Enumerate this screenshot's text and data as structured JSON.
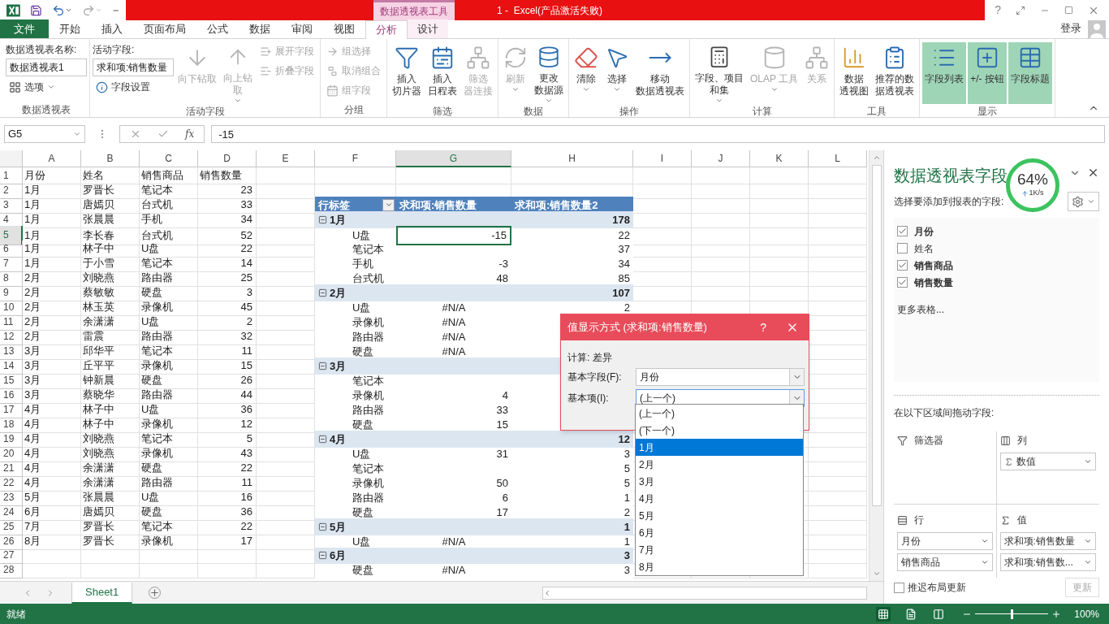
{
  "titlebar": {
    "context_tab": "数据透视表工具",
    "title": "1 -  Excel(产品激活失败)",
    "help": "?"
  },
  "tabs": [
    {
      "label": "文件",
      "kind": "file",
      "selected": false
    },
    {
      "label": "开始",
      "kind": "normal",
      "selected": false
    },
    {
      "label": "插入",
      "kind": "normal",
      "selected": false
    },
    {
      "label": "页面布局",
      "kind": "normal",
      "selected": false
    },
    {
      "label": "公式",
      "kind": "normal",
      "selected": false
    },
    {
      "label": "数据",
      "kind": "normal",
      "selected": false
    },
    {
      "label": "审阅",
      "kind": "normal",
      "selected": false
    },
    {
      "label": "视图",
      "kind": "normal",
      "selected": false
    },
    {
      "label": "分析",
      "kind": "context",
      "selected": true
    },
    {
      "label": "设计",
      "kind": "context",
      "selected": false
    }
  ],
  "account": {
    "label": "登录"
  },
  "ribbon": {
    "groups": [
      {
        "label": "数据透视表",
        "columns": [
          [
            {
              "kind": "caption",
              "label": "数据透视表名称:"
            },
            {
              "kind": "input",
              "value": "数据透视表1"
            },
            {
              "kind": "small",
              "label": "选项",
              "menu": true,
              "disabled": false
            }
          ]
        ]
      },
      {
        "label": "活动字段",
        "columns": [
          [
            {
              "kind": "caption",
              "label": "活动字段:"
            },
            {
              "kind": "input",
              "value": "求和项:销售数量"
            },
            {
              "kind": "small",
              "label": "字段设置",
              "menu": false,
              "disabled": false
            }
          ],
          [
            {
              "kind": "large",
              "label": "向下钻取",
              "menu": false,
              "disabled": true
            }
          ],
          [
            {
              "kind": "large",
              "label": "向上钻取",
              "menu": true,
              "disabled": true
            }
          ],
          [
            {
              "kind": "small",
              "label": "展开字段",
              "menu": false,
              "disabled": true
            },
            {
              "kind": "small",
              "label": "折叠字段",
              "menu": false,
              "disabled": true
            }
          ]
        ]
      },
      {
        "label": "分组",
        "columns": [
          [
            {
              "kind": "small",
              "label": "组选择",
              "menu": false,
              "disabled": true
            },
            {
              "kind": "small",
              "label": "取消组合",
              "menu": false,
              "disabled": true
            },
            {
              "kind": "small",
              "label": "组字段",
              "menu": false,
              "disabled": true
            }
          ]
        ]
      },
      {
        "label": "筛选",
        "columns": [
          [
            {
              "kind": "large",
              "label": "插入切片器",
              "menu": false,
              "disabled": false
            }
          ],
          [
            {
              "kind": "large",
              "label": "插入日程表",
              "menu": false,
              "disabled": false
            }
          ],
          [
            {
              "kind": "large",
              "label": "筛选器连接",
              "menu": false,
              "disabled": true
            }
          ]
        ]
      },
      {
        "label": "数据",
        "columns": [
          [
            {
              "kind": "large",
              "label": "刷新",
              "menu": true,
              "disabled": true
            }
          ],
          [
            {
              "kind": "large",
              "label": "更改数据源",
              "menu": true,
              "disabled": false
            }
          ]
        ]
      },
      {
        "label": "操作",
        "columns": [
          [
            {
              "kind": "large",
              "label": "清除",
              "menu": true,
              "disabled": false
            }
          ],
          [
            {
              "kind": "large",
              "label": "选择",
              "menu": true,
              "disabled": false
            }
          ],
          [
            {
              "kind": "large",
              "label": "移动数据透视表",
              "menu": false,
              "disabled": false
            }
          ]
        ]
      },
      {
        "label": "计算",
        "columns": [
          [
            {
              "kind": "large",
              "label": "字段、项目和集",
              "menu": true,
              "disabled": false
            }
          ],
          [
            {
              "kind": "large",
              "label": "OLAP 工具",
              "menu": true,
              "disabled": true
            }
          ],
          [
            {
              "kind": "large",
              "label": "关系",
              "menu": false,
              "disabled": true
            }
          ]
        ]
      },
      {
        "label": "工具",
        "columns": [
          [
            {
              "kind": "large",
              "label": "数据透视图",
              "menu": false,
              "disabled": false
            }
          ],
          [
            {
              "kind": "large",
              "label": "推荐的数据透视表",
              "menu": false,
              "disabled": false
            }
          ]
        ]
      },
      {
        "label": "显示",
        "columns": [
          [
            {
              "kind": "large",
              "label": "字段列表",
              "menu": false,
              "disabled": false,
              "selected": true
            }
          ],
          [
            {
              "kind": "large",
              "label": "+/- 按钮",
              "menu": false,
              "disabled": false,
              "selected": true
            }
          ],
          [
            {
              "kind": "large",
              "label": "字段标题",
              "menu": false,
              "disabled": false,
              "selected": true
            }
          ]
        ]
      }
    ]
  },
  "formula_bar": {
    "name_box": "G5",
    "function_label": "fx",
    "formula": "-15"
  },
  "sheet": {
    "columns": [
      {
        "label": "A",
        "selected": false
      },
      {
        "label": "B",
        "selected": false
      },
      {
        "label": "C",
        "selected": false
      },
      {
        "label": "D",
        "selected": false
      },
      {
        "label": "E",
        "selected": false
      },
      {
        "label": "F",
        "selected": false
      },
      {
        "label": "G",
        "selected": true
      },
      {
        "label": "H",
        "selected": false
      },
      {
        "label": "I",
        "selected": false
      },
      {
        "label": "J",
        "selected": false
      },
      {
        "label": "K",
        "selected": false
      },
      {
        "label": "L",
        "selected": false
      }
    ],
    "rows": [
      {
        "number": "1",
        "selected": false,
        "cells": [
          "月份",
          "姓名",
          "销售商品",
          "销售数量"
        ]
      },
      {
        "number": "2",
        "selected": false,
        "cells": [
          "1月",
          "罗晋长",
          "笔记本",
          "23"
        ]
      },
      {
        "number": "3",
        "selected": false,
        "cells": [
          "1月",
          "唐嫣贝",
          "台式机",
          "33"
        ],
        "pivot": {
          "kind": "header",
          "label": "行标签",
          "value": "求和项:销售数量",
          "total": "求和项:销售数量2"
        }
      },
      {
        "number": "4",
        "selected": false,
        "cells": [
          "1月",
          "张晨晨",
          "手机",
          "34"
        ],
        "pivot": {
          "kind": "group",
          "label": "1月",
          "total": "178"
        }
      },
      {
        "number": "5",
        "selected": true,
        "cells": [
          "1月",
          "李长春",
          "台式机",
          "52"
        ],
        "pivot": {
          "kind": "item",
          "label": "U盘",
          "value": "-15",
          "total": "22",
          "value_error": false,
          "value_selected": true
        }
      },
      {
        "number": "6",
        "selected": false,
        "cells": [
          "1月",
          "林子中",
          "U盘",
          "22"
        ],
        "pivot": {
          "kind": "item",
          "label": "笔记本",
          "total": "37",
          "value_selected": false
        }
      },
      {
        "number": "7",
        "selected": false,
        "cells": [
          "1月",
          "于小雪",
          "笔记本",
          "14"
        ],
        "pivot": {
          "kind": "item",
          "label": "手机",
          "value": "-3",
          "total": "34",
          "value_error": false,
          "value_selected": false
        }
      },
      {
        "number": "8",
        "selected": false,
        "cells": [
          "2月",
          "刘晓燕",
          "路由器",
          "25"
        ],
        "pivot": {
          "kind": "item",
          "label": "台式机",
          "value": "48",
          "total": "85",
          "value_error": false,
          "value_selected": false
        }
      },
      {
        "number": "9",
        "selected": false,
        "cells": [
          "2月",
          "蔡敏敏",
          "硬盘",
          "3"
        ],
        "pivot": {
          "kind": "group",
          "label": "2月",
          "total": "107"
        }
      },
      {
        "number": "10",
        "selected": false,
        "cells": [
          "2月",
          "林玉英",
          "录像机",
          "45"
        ],
        "pivot": {
          "kind": "item",
          "label": "U盘",
          "value": "#N/A",
          "total": "2",
          "value_error": true,
          "value_selected": false
        }
      },
      {
        "number": "11",
        "selected": false,
        "cells": [
          "2月",
          "余潇潇",
          "U盘",
          "2"
        ],
        "pivot": {
          "kind": "item",
          "label": "录像机",
          "value": "#N/A",
          "value_error": true,
          "value_selected": false
        }
      },
      {
        "number": "12",
        "selected": false,
        "cells": [
          "2月",
          "雷震",
          "路由器",
          "32"
        ],
        "pivot": {
          "kind": "item",
          "label": "路由器",
          "value": "#N/A",
          "value_error": true,
          "value_selected": false
        }
      },
      {
        "number": "13",
        "selected": false,
        "cells": [
          "3月",
          "邱华平",
          "笔记本",
          "11"
        ],
        "pivot": {
          "kind": "item",
          "label": "硬盘",
          "value": "#N/A",
          "value_error": true,
          "value_selected": false
        }
      },
      {
        "number": "14",
        "selected": false,
        "cells": [
          "3月",
          "丘平平",
          "录像机",
          "15"
        ],
        "pivot": {
          "kind": "group",
          "label": "3月"
        }
      },
      {
        "number": "15",
        "selected": false,
        "cells": [
          "3月",
          "钟新晨",
          "硬盘",
          "26"
        ],
        "pivot": {
          "kind": "item",
          "label": "笔记本",
          "value_selected": false
        }
      },
      {
        "number": "16",
        "selected": false,
        "cells": [
          "3月",
          "蔡晓华",
          "路由器",
          "44"
        ],
        "pivot": {
          "kind": "item",
          "label": "录像机",
          "value": "4",
          "value_error": false,
          "value_selected": false
        }
      },
      {
        "number": "17",
        "selected": false,
        "cells": [
          "4月",
          "林子中",
          "U盘",
          "36"
        ],
        "pivot": {
          "kind": "item",
          "label": "路由器",
          "value": "33",
          "value_error": false,
          "value_selected": false
        }
      },
      {
        "number": "18",
        "selected": false,
        "cells": [
          "4月",
          "林子中",
          "录像机",
          "12"
        ],
        "pivot": {
          "kind": "item",
          "label": "硬盘",
          "value": "15",
          "value_error": false,
          "value_selected": false
        }
      },
      {
        "number": "19",
        "selected": false,
        "cells": [
          "4月",
          "刘晓燕",
          "笔记本",
          "5"
        ],
        "pivot": {
          "kind": "group",
          "label": "4月",
          "total": "12"
        }
      },
      {
        "number": "20",
        "selected": false,
        "cells": [
          "4月",
          "刘晓燕",
          "录像机",
          "43"
        ],
        "pivot": {
          "kind": "item",
          "label": "U盘",
          "value": "31",
          "total": "3",
          "value_error": false,
          "value_selected": false
        }
      },
      {
        "number": "21",
        "selected": false,
        "cells": [
          "4月",
          "余潇潇",
          "硬盘",
          "22"
        ],
        "pivot": {
          "kind": "item",
          "label": "笔记本",
          "total": "5",
          "value_selected": false
        }
      },
      {
        "number": "22",
        "selected": false,
        "cells": [
          "4月",
          "余潇潇",
          "路由器",
          "11"
        ],
        "pivot": {
          "kind": "item",
          "label": "录像机",
          "value": "50",
          "total": "5",
          "value_error": false,
          "value_selected": false
        }
      },
      {
        "number": "23",
        "selected": false,
        "cells": [
          "5月",
          "张晨晨",
          "U盘",
          "16"
        ],
        "pivot": {
          "kind": "item",
          "label": "路由器",
          "value": "6",
          "total": "1",
          "value_error": false,
          "value_selected": false
        }
      },
      {
        "number": "24",
        "selected": false,
        "cells": [
          "6月",
          "唐嫣贝",
          "硬盘",
          "36"
        ],
        "pivot": {
          "kind": "item",
          "label": "硬盘",
          "value": "17",
          "total": "2",
          "value_error": false,
          "value_selected": false
        }
      },
      {
        "number": "25",
        "selected": false,
        "cells": [
          "7月",
          "罗晋长",
          "笔记本",
          "22"
        ],
        "pivot": {
          "kind": "group",
          "label": "5月",
          "total": "1"
        }
      },
      {
        "number": "26",
        "selected": false,
        "cells": [
          "8月",
          "罗晋长",
          "录像机",
          "17"
        ],
        "pivot": {
          "kind": "item",
          "label": "U盘",
          "value": "#N/A",
          "total": "1",
          "value_error": true,
          "value_selected": false
        }
      },
      {
        "number": "27",
        "selected": false,
        "pivot": {
          "kind": "group",
          "label": "6月",
          "total": "3"
        }
      },
      {
        "number": "28",
        "selected": false,
        "pivot": {
          "kind": "item",
          "label": "硬盘",
          "value": "#N/A",
          "total": "3",
          "value_error": true,
          "value_selected": false
        }
      }
    ]
  },
  "dialog": {
    "title": "值显示方式 (求和项:销售数量)",
    "help": "?",
    "calculation": "计算: 差异",
    "fields": [
      {
        "label": "基本字段(F):",
        "value": "月份",
        "expanded": false
      },
      {
        "label": "基本项(I):",
        "value": "(上一个)",
        "expanded": true
      }
    ],
    "options": [
      {
        "label": "(上一个)",
        "selected": false
      },
      {
        "label": "(下一个)",
        "selected": false
      },
      {
        "label": "1月",
        "selected": true
      },
      {
        "label": "2月",
        "selected": false
      },
      {
        "label": "3月",
        "selected": false
      },
      {
        "label": "4月",
        "selected": false
      },
      {
        "label": "5月",
        "selected": false
      },
      {
        "label": "6月",
        "selected": false
      },
      {
        "label": "7月",
        "selected": false
      },
      {
        "label": "8月",
        "selected": false
      }
    ]
  },
  "field_pane": {
    "title": "数据透视表字段",
    "subtitle": "选择要添加到报表的字段:",
    "fields": [
      {
        "label": "月份",
        "checked": true
      },
      {
        "label": "姓名",
        "checked": false
      },
      {
        "label": "销售商品",
        "checked": true
      },
      {
        "label": "销售数量",
        "checked": true
      }
    ],
    "more_tables": "更多表格...",
    "areas_caption": "在以下区域间拖动字段:",
    "areas": [
      {
        "label": "筛选器"
      },
      {
        "label": "列",
        "items": [
          "数值"
        ]
      },
      {
        "label": "行",
        "items": [
          "月份",
          "销售商品"
        ]
      },
      {
        "label": "值",
        "items": [
          "求和项:销售数量",
          "求和项:销售数..."
        ]
      }
    ],
    "defer": {
      "label": "推迟布局更新",
      "checked": false
    },
    "update_button": {
      "label": "更新",
      "disabled": true
    }
  },
  "speed_widget": {
    "percent": "64%",
    "rate": "1K/s"
  },
  "sheet_tabs": [
    {
      "label": "Sheet1",
      "selected": true
    }
  ],
  "status_bar": {
    "status": "就绪",
    "views": [
      {
        "selected": true
      },
      {
        "selected": false
      },
      {
        "selected": false
      }
    ],
    "zoom": {
      "level": 0.5,
      "reading": "100%"
    }
  }
}
